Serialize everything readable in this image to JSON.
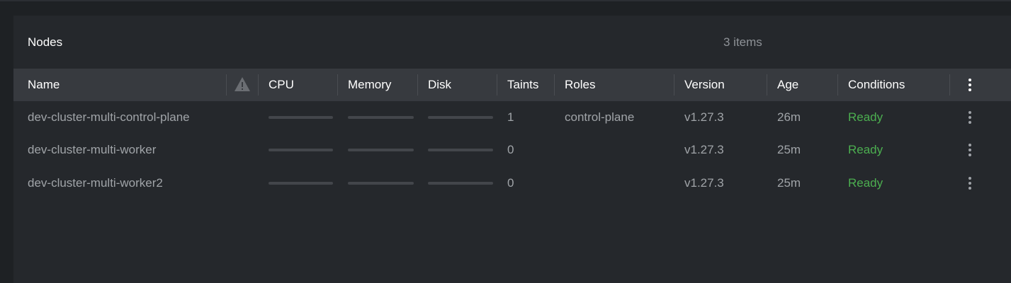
{
  "panel": {
    "title": "Nodes",
    "count_label": "3 items"
  },
  "columns": {
    "name": "Name",
    "warnings_icon": "warning-icon",
    "cpu": "CPU",
    "memory": "Memory",
    "disk": "Disk",
    "taints": "Taints",
    "roles": "Roles",
    "version": "Version",
    "age": "Age",
    "conditions": "Conditions",
    "menu_icon": "kebab-menu-icon"
  },
  "rows": [
    {
      "name": "dev-cluster-multi-control-plane",
      "cpu_usage": 0,
      "memory_usage": 0,
      "disk_usage": 0,
      "taints": "1",
      "roles": "control-plane",
      "version": "v1.27.3",
      "age": "26m",
      "conditions": "Ready"
    },
    {
      "name": "dev-cluster-multi-worker",
      "cpu_usage": 0,
      "memory_usage": 0,
      "disk_usage": 0,
      "taints": "0",
      "roles": "",
      "version": "v1.27.3",
      "age": "25m",
      "conditions": "Ready"
    },
    {
      "name": "dev-cluster-multi-worker2",
      "cpu_usage": 0,
      "memory_usage": 0,
      "disk_usage": 0,
      "taints": "0",
      "roles": "",
      "version": "v1.27.3",
      "age": "25m",
      "conditions": "Ready"
    }
  ],
  "colors": {
    "background": "#1e2124",
    "panel": "#25282c",
    "header_row": "#373a3f",
    "ready": "#4caf50",
    "muted_text": "#a0a4a8"
  }
}
